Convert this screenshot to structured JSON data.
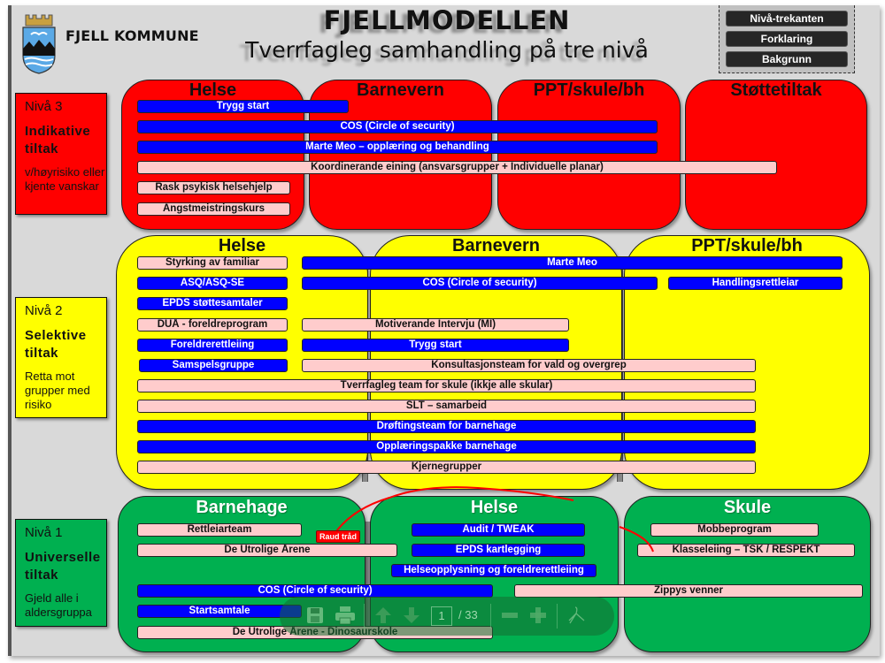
{
  "header": {
    "org_name": "FJELL KOMMUNE",
    "title": "FJELLMODELLEN",
    "subtitle": "Tverrfagleg samhandling på tre nivå"
  },
  "nav_buttons": [
    {
      "label": "Nivå-trekanten"
    },
    {
      "label": "Forklaring"
    },
    {
      "label": "Bakgrunn"
    }
  ],
  "colors": {
    "level3": "#ff0000",
    "level2": "#ffff00",
    "level1": "#00b050",
    "bar_blue": "#0000ff",
    "bar_pink": "#ffcccc",
    "red_thread": "#ff0000"
  },
  "levels": {
    "level3": {
      "label": "Nivå 3",
      "type": "Indikative tiltak",
      "description": "v/høyrisiko eller kjente vanskar",
      "columns": [
        "Helse",
        "Barnevern",
        "PPT/skule/bh",
        "Støttetiltak"
      ],
      "bars": [
        {
          "label": "Trygg start",
          "style": "blue"
        },
        {
          "label": "COS (Circle of security)",
          "style": "blue"
        },
        {
          "label": "Marte Meo – opplæring og behandling",
          "style": "blue"
        },
        {
          "label": "Koordinerande eining (ansvarsgrupper + Individuelle planar)",
          "style": "pink"
        },
        {
          "label": "Rask psykisk helsehjelp",
          "style": "pink"
        },
        {
          "label": "Angstmeistringskurs",
          "style": "pink"
        }
      ]
    },
    "level2": {
      "label": "Nivå 2",
      "type": "Selektive tiltak",
      "description": "Retta mot grupper med risiko",
      "columns": [
        "Helse",
        "Barnevern",
        "PPT/skule/bh"
      ],
      "bars": [
        {
          "label": "Styrking av familiar",
          "style": "pink"
        },
        {
          "label": "Marte Meo",
          "style": "blue"
        },
        {
          "label": "ASQ/ASQ-SE",
          "style": "blue"
        },
        {
          "label": "COS (Circle of security)",
          "style": "blue"
        },
        {
          "label": "Handlingsrettleiar",
          "style": "blue"
        },
        {
          "label": "EPDS støttesamtaler",
          "style": "blue"
        },
        {
          "label": "DUÅ - foreldreprogram",
          "style": "pink"
        },
        {
          "label": "Motiverande Intervju (MI)",
          "style": "pink"
        },
        {
          "label": "Foreldrerettleiing",
          "style": "blue"
        },
        {
          "label": "Trygg start",
          "style": "blue"
        },
        {
          "label": "Samspelsgruppe",
          "style": "blue"
        },
        {
          "label": "Konsultasjonsteam for vald og overgrep",
          "style": "pink"
        },
        {
          "label": "Tverrfagleg team for skule (ikkje alle skular)",
          "style": "pink"
        },
        {
          "label": "SLT – samarbeid",
          "style": "pink"
        },
        {
          "label": "Drøftingsteam for barnehage",
          "style": "blue"
        },
        {
          "label": "Opplæringspakke barnehage",
          "style": "blue"
        },
        {
          "label": "Kjernegrupper",
          "style": "pink"
        }
      ]
    },
    "level1": {
      "label": "Nivå 1",
      "type": "Universelle tiltak",
      "description": "Gjeld alle i aldersgruppa",
      "columns": [
        "Barnehage",
        "Helse",
        "Skule"
      ],
      "bars": [
        {
          "label": "Rettleiarteam",
          "style": "pink"
        },
        {
          "label": "Audit / TWEAK",
          "style": "blue"
        },
        {
          "label": "Mobbeprogram",
          "style": "pink"
        },
        {
          "label": "De Utrolige Årene",
          "style": "pink"
        },
        {
          "label": "EPDS kartlegging",
          "style": "blue"
        },
        {
          "label": "Klasseleiing – TSK / RESPEKT",
          "style": "pink"
        },
        {
          "label": "Helseopplysning og foreldrerettleiing",
          "style": "blue"
        },
        {
          "label": "COS (Circle of security)",
          "style": "blue"
        },
        {
          "label": "Zippys venner",
          "style": "pink"
        },
        {
          "label": "Startsamtale",
          "style": "blue"
        },
        {
          "label": "De Utrolige Årene - Dinosaurskole",
          "style": "pink"
        }
      ],
      "red_thread_label": "Raud tråd"
    }
  },
  "pdf_toolbar": {
    "current_page": "1",
    "total_pages": "/ 33",
    "icons": [
      "save-icon",
      "print-icon",
      "arrow-up-icon",
      "arrow-down-icon",
      "zoom-out-icon",
      "zoom-in-icon",
      "acrobat-icon"
    ]
  }
}
